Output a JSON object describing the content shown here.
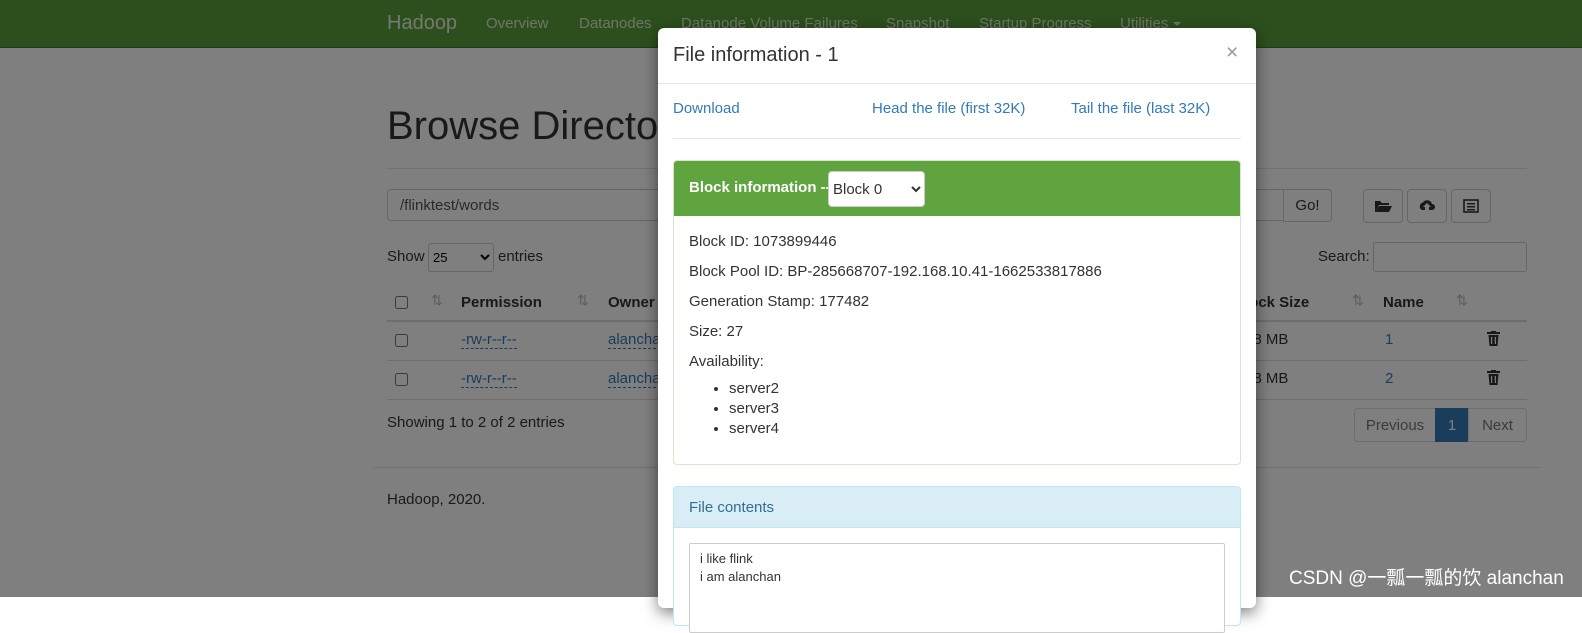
{
  "navbar": {
    "brand": "Hadoop",
    "items": [
      "Overview",
      "Datanodes",
      "Datanode Volume Failures",
      "Snapshot",
      "Startup Progress",
      "Utilities"
    ]
  },
  "browse": {
    "title": "Browse Director",
    "path_value": "/flinktest/words",
    "go_label": "Go!",
    "show_label": "Show",
    "page_length": "25",
    "entries_label": "entries",
    "search_label": "Search:",
    "columns": [
      "Permission",
      "Owner",
      "lock Size",
      "Name"
    ],
    "rows": [
      {
        "permission": "-rw-r--r--",
        "owner": "alancha",
        "block_size": "28 MB",
        "name": "1"
      },
      {
        "permission": "-rw-r--r--",
        "owner": "alancha",
        "block_size": "28 MB",
        "name": "2"
      }
    ],
    "showing": "Showing 1 to 2 of 2 entries",
    "pagination": {
      "previous": "Previous",
      "current": "1",
      "next": "Next"
    },
    "footer": "Hadoop, 2020."
  },
  "modal": {
    "title": "File information - 1",
    "close": "×",
    "links": {
      "download": "Download",
      "head": "Head the file (first 32K)",
      "tail": "Tail the file (last 32K)"
    },
    "block_panel": {
      "title": "Block information --",
      "selected_block": "Block 0",
      "block_id": "Block ID: 1073899446",
      "block_pool_id": "Block Pool ID: BP-285668707-192.168.10.41-1662533817886",
      "generation_stamp": "Generation Stamp: 177482",
      "size": "Size: 27",
      "availability_label": "Availability:",
      "servers": [
        "server2",
        "server3",
        "server4"
      ]
    },
    "contents_panel": {
      "title": "File contents",
      "text": "i like flink\ni am alanchan"
    }
  },
  "watermark": "CSDN @一瓢一瓢的饮 alanchan",
  "colors": {
    "navbar": "#5a9e3b",
    "block_header": "#5fa43f",
    "link": "#337ab7",
    "contents_header": "#d9edf7",
    "pager_active": "#337ab7"
  }
}
